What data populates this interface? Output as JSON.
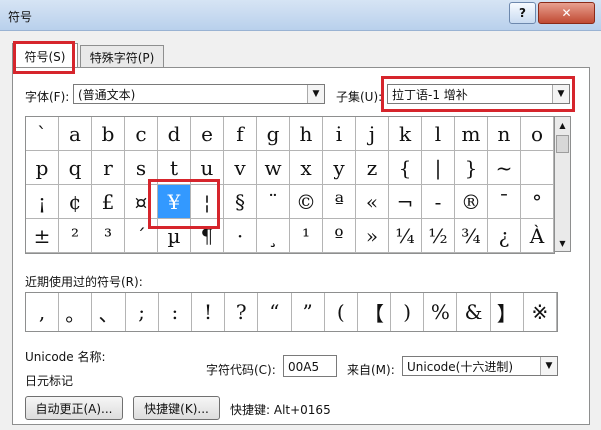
{
  "window": {
    "title": "符号",
    "help_label": "?",
    "close_label": "✕"
  },
  "tabs": [
    {
      "label": "符号(S)"
    },
    {
      "label": "特殊字符(P)"
    }
  ],
  "font": {
    "label": "字体(F):",
    "value": "(普通文本)"
  },
  "subset": {
    "label": "子集(U):",
    "value": "拉丁语-1 增补"
  },
  "symbols": [
    [
      "`",
      "a",
      "b",
      "c",
      "d",
      "e",
      "f",
      "g",
      "h",
      "i",
      "j",
      "k",
      "l",
      "m",
      "n",
      "o"
    ],
    [
      "p",
      "q",
      "r",
      "s",
      "t",
      "u",
      "v",
      "w",
      "x",
      "y",
      "z",
      "{",
      "|",
      "}",
      "~",
      ""
    ],
    [
      "¡",
      "¢",
      "£",
      "¤",
      "¥",
      "¦",
      "§",
      "¨",
      "©",
      "ª",
      "«",
      "¬",
      "-",
      "®",
      "¯",
      "°"
    ],
    [
      "±",
      "²",
      "³",
      "´",
      "µ",
      "¶",
      "·",
      "¸",
      "¹",
      "º",
      "»",
      "¼",
      "½",
      "¾",
      "¿",
      "À"
    ]
  ],
  "selected_symbol": "¥",
  "recent": {
    "label": "近期使用过的符号(R):",
    "symbols": [
      ",",
      "。",
      "、",
      ";",
      ":",
      "!",
      "?",
      "“",
      "”",
      "(",
      "【",
      ")",
      "%",
      "&",
      "】",
      "※"
    ]
  },
  "unicode_name_label": "Unicode 名称:",
  "unicode_name_value": "日元标记",
  "char_code": {
    "label": "字符代码(C):",
    "value": "00A5"
  },
  "from": {
    "label": "来自(M):",
    "value": "Unicode(十六进制)"
  },
  "buttons": {
    "autocorrect": "自动更正(A)...",
    "shortcut_key": "快捷键(K)..."
  },
  "shortcut_text": "快捷键: Alt+0165",
  "colors": {
    "selection": "#3399ff",
    "highlight": "#d6252c"
  }
}
